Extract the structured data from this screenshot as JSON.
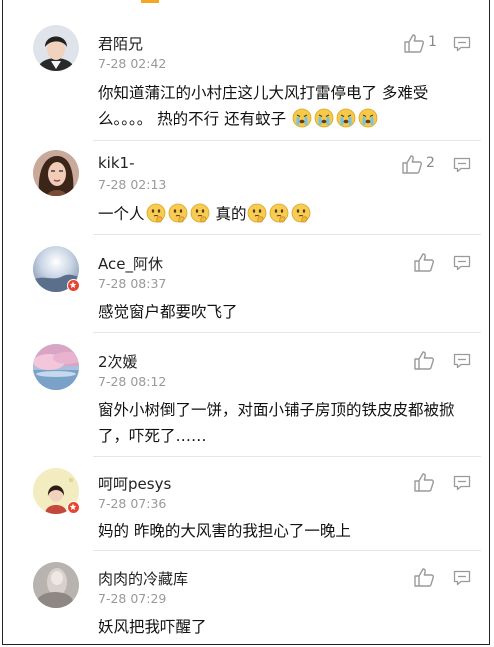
{
  "comments": [
    {
      "username": "君陌兄",
      "time": "7-28 02:42",
      "like_count": "1",
      "avatar": "avatar-boy",
      "verified": false,
      "text": "你知道蒲江的小村庄这儿大风打雷停电了 多难受么。。。。 热的不行 还有蚊子",
      "emojis": [
        "crying-emoji",
        "crying-emoji",
        "crying-emoji",
        "crying-emoji"
      ]
    },
    {
      "username": "kik1-",
      "time": "7-28 02:13",
      "like_count": "2",
      "avatar": "avatar-woman",
      "verified": false,
      "text_before": "一个人",
      "text_after": "真的",
      "emojis_before": [
        "thinking-emoji",
        "thinking-emoji",
        "thinking-emoji"
      ],
      "emojis_after": [
        "thinking-emoji",
        "thinking-emoji",
        "thinking-emoji"
      ]
    },
    {
      "username": "Ace_阿休",
      "time": "7-28 08:37",
      "like_count": "",
      "avatar": "avatar-sky",
      "verified": true,
      "text": "感觉窗户都要吹飞了"
    },
    {
      "username": "2次媛",
      "time": "7-28 08:12",
      "like_count": "",
      "avatar": "avatar-pink-sky",
      "verified": false,
      "text": "窗外小树倒了一饼，对面小铺子房顶的铁皮皮都被掀了，吓死了……"
    },
    {
      "username": "呵呵pesys",
      "time": "7-28 07:36",
      "like_count": "",
      "avatar": "avatar-girl-yellow",
      "verified": true,
      "text": "妈的 昨晚的大风害的我担心了一晚上"
    },
    {
      "username": "肉肉的冷藏库",
      "time": "7-28 07:29",
      "like_count": "",
      "avatar": "avatar-gray-photo",
      "verified": false,
      "text": "妖风把我吓醒了"
    }
  ],
  "colors": {
    "verified_badge": "#e8442f",
    "divider": "#e6e6e6",
    "time": "#999999",
    "icon": "#9a9a9a"
  }
}
